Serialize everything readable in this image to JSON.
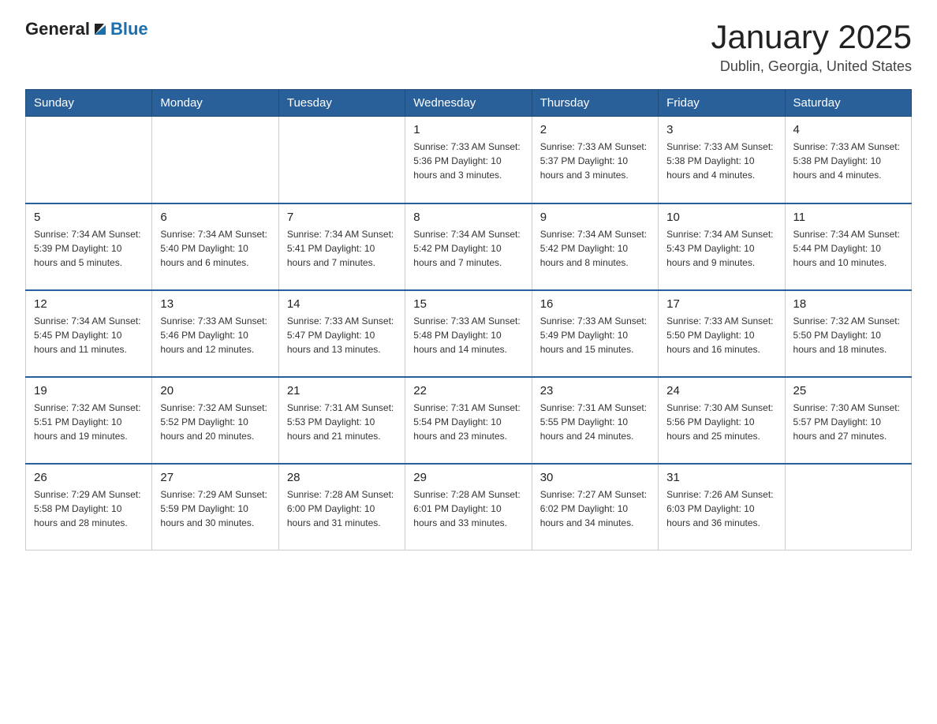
{
  "header": {
    "logo_general": "General",
    "logo_blue": "Blue",
    "title": "January 2025",
    "subtitle": "Dublin, Georgia, United States"
  },
  "days_of_week": [
    "Sunday",
    "Monday",
    "Tuesday",
    "Wednesday",
    "Thursday",
    "Friday",
    "Saturday"
  ],
  "weeks": [
    [
      {
        "day": "",
        "info": ""
      },
      {
        "day": "",
        "info": ""
      },
      {
        "day": "",
        "info": ""
      },
      {
        "day": "1",
        "info": "Sunrise: 7:33 AM\nSunset: 5:36 PM\nDaylight: 10 hours and 3 minutes."
      },
      {
        "day": "2",
        "info": "Sunrise: 7:33 AM\nSunset: 5:37 PM\nDaylight: 10 hours and 3 minutes."
      },
      {
        "day": "3",
        "info": "Sunrise: 7:33 AM\nSunset: 5:38 PM\nDaylight: 10 hours and 4 minutes."
      },
      {
        "day": "4",
        "info": "Sunrise: 7:33 AM\nSunset: 5:38 PM\nDaylight: 10 hours and 4 minutes."
      }
    ],
    [
      {
        "day": "5",
        "info": "Sunrise: 7:34 AM\nSunset: 5:39 PM\nDaylight: 10 hours and 5 minutes."
      },
      {
        "day": "6",
        "info": "Sunrise: 7:34 AM\nSunset: 5:40 PM\nDaylight: 10 hours and 6 minutes."
      },
      {
        "day": "7",
        "info": "Sunrise: 7:34 AM\nSunset: 5:41 PM\nDaylight: 10 hours and 7 minutes."
      },
      {
        "day": "8",
        "info": "Sunrise: 7:34 AM\nSunset: 5:42 PM\nDaylight: 10 hours and 7 minutes."
      },
      {
        "day": "9",
        "info": "Sunrise: 7:34 AM\nSunset: 5:42 PM\nDaylight: 10 hours and 8 minutes."
      },
      {
        "day": "10",
        "info": "Sunrise: 7:34 AM\nSunset: 5:43 PM\nDaylight: 10 hours and 9 minutes."
      },
      {
        "day": "11",
        "info": "Sunrise: 7:34 AM\nSunset: 5:44 PM\nDaylight: 10 hours and 10 minutes."
      }
    ],
    [
      {
        "day": "12",
        "info": "Sunrise: 7:34 AM\nSunset: 5:45 PM\nDaylight: 10 hours and 11 minutes."
      },
      {
        "day": "13",
        "info": "Sunrise: 7:33 AM\nSunset: 5:46 PM\nDaylight: 10 hours and 12 minutes."
      },
      {
        "day": "14",
        "info": "Sunrise: 7:33 AM\nSunset: 5:47 PM\nDaylight: 10 hours and 13 minutes."
      },
      {
        "day": "15",
        "info": "Sunrise: 7:33 AM\nSunset: 5:48 PM\nDaylight: 10 hours and 14 minutes."
      },
      {
        "day": "16",
        "info": "Sunrise: 7:33 AM\nSunset: 5:49 PM\nDaylight: 10 hours and 15 minutes."
      },
      {
        "day": "17",
        "info": "Sunrise: 7:33 AM\nSunset: 5:50 PM\nDaylight: 10 hours and 16 minutes."
      },
      {
        "day": "18",
        "info": "Sunrise: 7:32 AM\nSunset: 5:50 PM\nDaylight: 10 hours and 18 minutes."
      }
    ],
    [
      {
        "day": "19",
        "info": "Sunrise: 7:32 AM\nSunset: 5:51 PM\nDaylight: 10 hours and 19 minutes."
      },
      {
        "day": "20",
        "info": "Sunrise: 7:32 AM\nSunset: 5:52 PM\nDaylight: 10 hours and 20 minutes."
      },
      {
        "day": "21",
        "info": "Sunrise: 7:31 AM\nSunset: 5:53 PM\nDaylight: 10 hours and 21 minutes."
      },
      {
        "day": "22",
        "info": "Sunrise: 7:31 AM\nSunset: 5:54 PM\nDaylight: 10 hours and 23 minutes."
      },
      {
        "day": "23",
        "info": "Sunrise: 7:31 AM\nSunset: 5:55 PM\nDaylight: 10 hours and 24 minutes."
      },
      {
        "day": "24",
        "info": "Sunrise: 7:30 AM\nSunset: 5:56 PM\nDaylight: 10 hours and 25 minutes."
      },
      {
        "day": "25",
        "info": "Sunrise: 7:30 AM\nSunset: 5:57 PM\nDaylight: 10 hours and 27 minutes."
      }
    ],
    [
      {
        "day": "26",
        "info": "Sunrise: 7:29 AM\nSunset: 5:58 PM\nDaylight: 10 hours and 28 minutes."
      },
      {
        "day": "27",
        "info": "Sunrise: 7:29 AM\nSunset: 5:59 PM\nDaylight: 10 hours and 30 minutes."
      },
      {
        "day": "28",
        "info": "Sunrise: 7:28 AM\nSunset: 6:00 PM\nDaylight: 10 hours and 31 minutes."
      },
      {
        "day": "29",
        "info": "Sunrise: 7:28 AM\nSunset: 6:01 PM\nDaylight: 10 hours and 33 minutes."
      },
      {
        "day": "30",
        "info": "Sunrise: 7:27 AM\nSunset: 6:02 PM\nDaylight: 10 hours and 34 minutes."
      },
      {
        "day": "31",
        "info": "Sunrise: 7:26 AM\nSunset: 6:03 PM\nDaylight: 10 hours and 36 minutes."
      },
      {
        "day": "",
        "info": ""
      }
    ]
  ]
}
